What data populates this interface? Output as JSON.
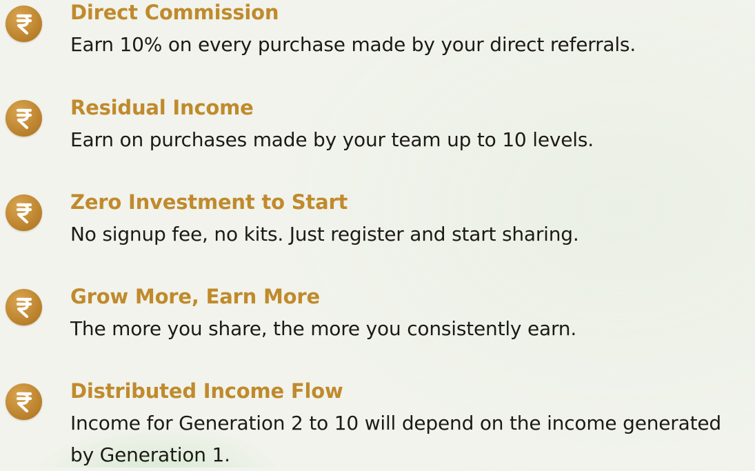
{
  "features": [
    {
      "icon": "rupee-icon",
      "title": "Direct Commission",
      "description": "Earn 10% on every purchase made by your direct referrals."
    },
    {
      "icon": "rupee-icon",
      "title": "Residual Income",
      "description": "Earn on purchases made by your team up to 10 levels."
    },
    {
      "icon": "rupee-icon",
      "title": "Zero Investment to Start",
      "description": "No signup fee, no kits. Just register and start sharing."
    },
    {
      "icon": "rupee-icon",
      "title": "Grow More, Earn More",
      "description": "The more you share, the more you consistently earn."
    },
    {
      "icon": "rupee-icon",
      "title": "Distributed Income Flow",
      "description": "Income for Generation 2 to 10 will depend on the income generated by Generation 1."
    }
  ],
  "colors": {
    "title": "#c08a2c",
    "icon_fill": "#b97f2a",
    "description": "#1c1a15",
    "background": "#f1f3ec"
  }
}
